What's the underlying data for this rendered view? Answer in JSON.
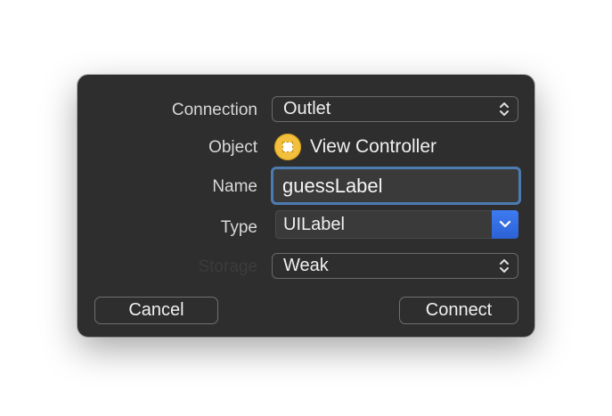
{
  "dialog": {
    "connection": {
      "label": "Connection",
      "value": "Outlet"
    },
    "object": {
      "label": "Object",
      "value": "View Controller",
      "icon": "view-controller-icon"
    },
    "name": {
      "label": "Name",
      "value": "guessLabel"
    },
    "type": {
      "label": "Type",
      "value": "UILabel"
    },
    "storage": {
      "label": "Storage",
      "value": "Weak"
    },
    "buttons": {
      "cancel": "Cancel",
      "connect": "Connect"
    }
  },
  "colors": {
    "background": "#2e2e2e",
    "focus_ring": "#4c7bb1",
    "accent": "#2f6ee0",
    "icon_yellow": "#f2c03c"
  }
}
